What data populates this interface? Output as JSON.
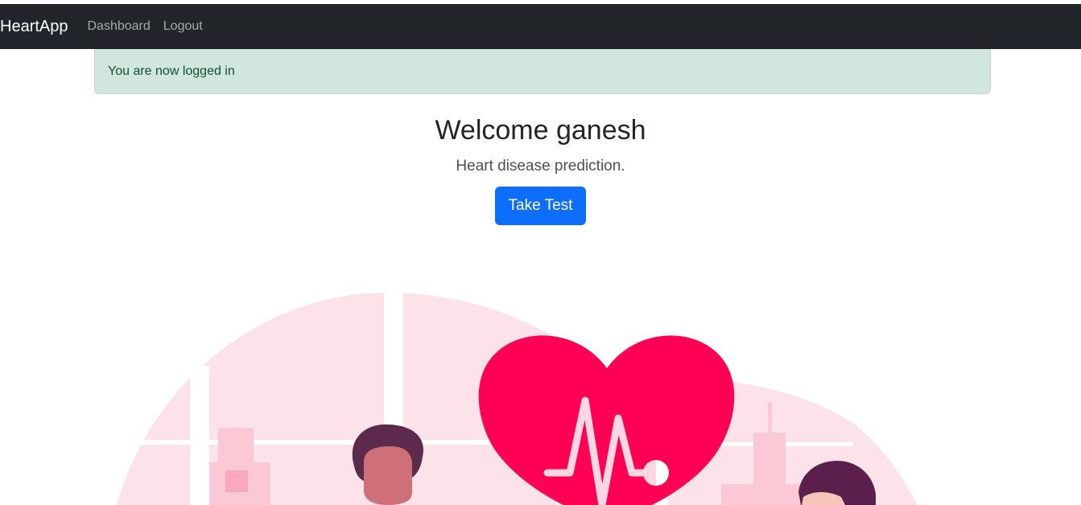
{
  "navbar": {
    "brand": "HeartApp",
    "links": [
      "Dashboard",
      "Logout"
    ]
  },
  "alert": {
    "message": "You are now logged in"
  },
  "hero": {
    "title": "Welcome ganesh",
    "subtitle": "Heart disease prediction.",
    "button_label": "Take Test"
  },
  "colors": {
    "navbar_bg": "#212529",
    "alert_bg": "#d1e7dd",
    "alert_text": "#0f5132",
    "primary": "#0d6efd",
    "heart": "#ff0055",
    "illustration_pink": "#fde2ea"
  },
  "icons": {
    "illustration": "heart-health-illustration"
  }
}
